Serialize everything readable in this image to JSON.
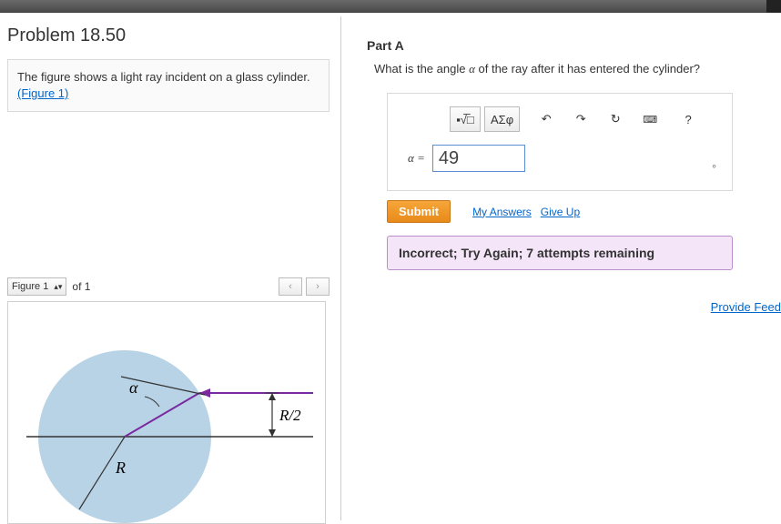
{
  "problem": {
    "title": "Problem 18.50",
    "prompt_text": "The figure shows a light ray incident on a glass cylinder.",
    "figure_link": "(Figure 1)"
  },
  "part": {
    "label": "Part A",
    "question_prefix": "What is the angle ",
    "question_var": "α",
    "question_suffix": " of the ray after it has entered the cylinder?"
  },
  "toolbar": {
    "templates": "▪√̅□",
    "greek": "ΑΣφ",
    "undo": "↶",
    "redo": "↷",
    "reset": "↻",
    "keyboard": "⌨",
    "help": "?"
  },
  "answer": {
    "var_label": "α =",
    "value": "49",
    "unit": "∘"
  },
  "actions": {
    "submit": "Submit",
    "my_answers": "My Answers",
    "give_up": "Give Up"
  },
  "feedback": {
    "text": "Incorrect; Try Again; 7 attempts remaining"
  },
  "links": {
    "provide_feedback": "Provide Feed"
  },
  "figure": {
    "selector_label": "Figure 1",
    "of_label": "of 1",
    "prev": "‹",
    "next": "›",
    "alpha_label": "α",
    "r_label": "R",
    "r2_label": "R/2"
  }
}
